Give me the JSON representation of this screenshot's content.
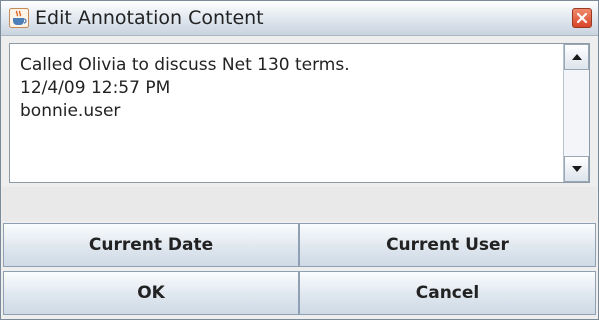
{
  "window": {
    "title": "Edit Annotation Content",
    "app_icon": "java-coffee-cup-icon",
    "close_icon": "close-icon"
  },
  "annotation": {
    "lines": [
      "Called Olivia to discuss Net 130 terms.",
      "12/4/09 12:57 PM",
      "bonnie.user"
    ]
  },
  "buttons": {
    "current_date": "Current Date",
    "current_user": "Current User",
    "ok": "OK",
    "cancel": "Cancel"
  },
  "colors": {
    "title_bar": "#dfe6ee",
    "close_button": "#d9452a",
    "button_face": "#dfe7ef",
    "border": "#8fa0b2"
  }
}
